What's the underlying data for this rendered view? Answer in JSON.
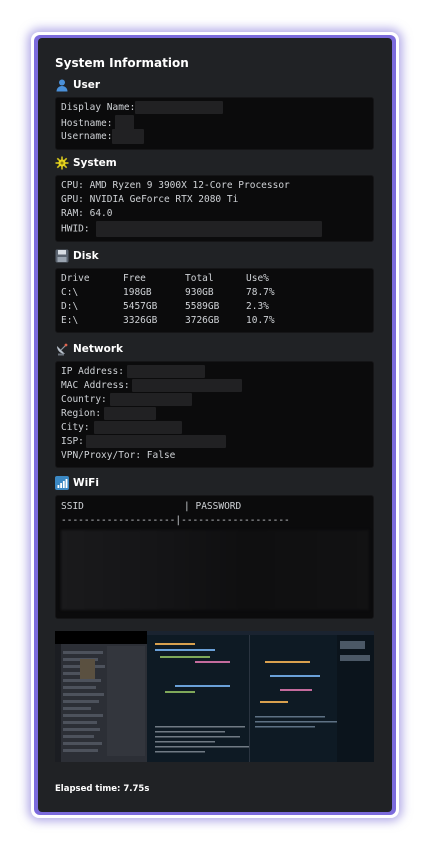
{
  "card": {
    "title": "System Information"
  },
  "user": {
    "heading": "User",
    "icon": "user-silhouette-icon",
    "lines": [
      {
        "label": "Display Name:",
        "value_hidden": true
      },
      {
        "label": "Hostname:",
        "value_hidden": true
      },
      {
        "label": "Username:",
        "value_hidden": true
      }
    ]
  },
  "system": {
    "heading": "System",
    "icon": "gear-sun-icon",
    "cpu": "CPU: AMD Ryzen 9 3900X 12-Core Processor",
    "gpu": "GPU: NVIDIA GeForce RTX 2080 Ti",
    "ram": "RAM: 64.0",
    "hwid_label": "HWID:"
  },
  "disk": {
    "heading": "Disk",
    "icon": "floppy-disk-icon",
    "headers": [
      "Drive",
      "Free",
      "Total",
      "Use%"
    ],
    "rows": [
      [
        "C:\\",
        "198GB",
        "930GB",
        "78.7%"
      ],
      [
        "D:\\",
        "5457GB",
        "5589GB",
        "2.3%"
      ],
      [
        "E:\\",
        "3326GB",
        "3726GB",
        "10.7%"
      ]
    ]
  },
  "network": {
    "heading": "Network",
    "icon": "satellite-dish-icon",
    "ip_label": "IP Address:",
    "mac_label": "MAC Address:",
    "country_label": "Country:",
    "region_label": "Region:",
    "city_label": "City:",
    "isp_label": "ISP:",
    "vpn_line": "VPN/Proxy/Tor: False"
  },
  "wifi": {
    "heading": "WiFi",
    "icon": "signal-bars-icon",
    "col_ssid": "SSID",
    "separator": "|",
    "col_password": "PASSWORD",
    "divider": "--------------------|-------------------"
  },
  "footer": {
    "elapsed": "Elapsed time: 7.75s"
  },
  "colors": {
    "card_bg": "#202225",
    "code_bg": "#0b0b0c",
    "accent_border": "#7c6bdc"
  }
}
